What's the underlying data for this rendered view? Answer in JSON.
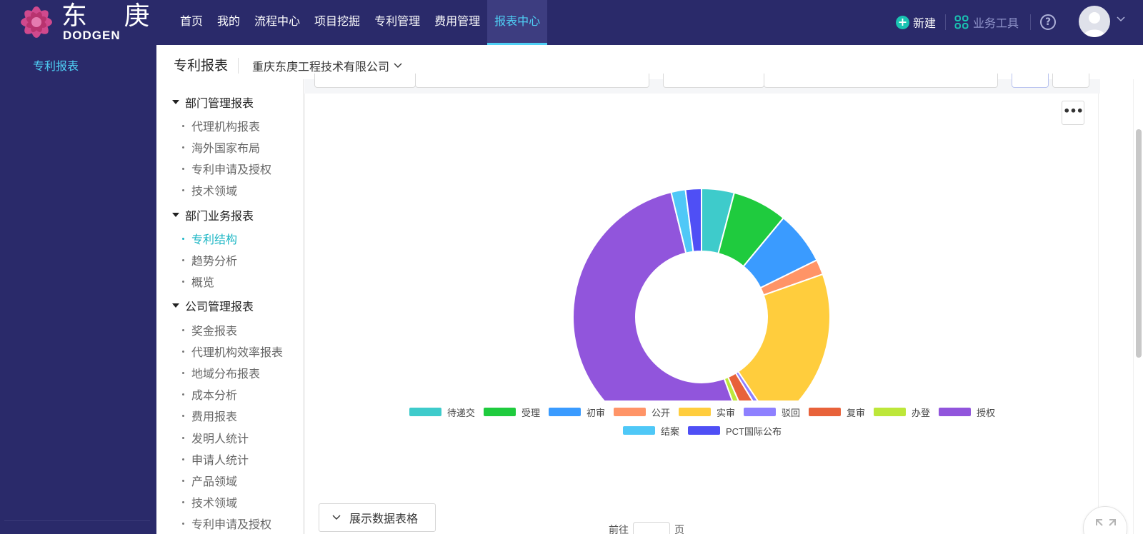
{
  "brand": {
    "name_cn": "东 庚",
    "name_en": "DODGEN"
  },
  "nav": {
    "items": [
      "首页",
      "我的",
      "流程中心",
      "项目挖掘",
      "专利管理",
      "费用管理",
      "报表中心"
    ],
    "active_index": 6
  },
  "toolbar": {
    "new_label": "新建",
    "biz_tools_label": "业务工具",
    "help_label": "?"
  },
  "sidebar": {
    "items": [
      "专利报表"
    ]
  },
  "page": {
    "title": "专利报表",
    "company": "重庆东庚工程技术有限公司"
  },
  "report_tree": {
    "groups": [
      {
        "label": "部门管理报表",
        "items": [
          "代理机构报表",
          "海外国家布局",
          "专利申请及授权",
          "技术领域"
        ]
      },
      {
        "label": "部门业务报表",
        "items": [
          "专利结构",
          "趋势分析",
          "概览"
        ]
      },
      {
        "label": "公司管理报表",
        "items": [
          "奖金报表",
          "代理机构效率报表",
          "地域分布报表",
          "成本分析",
          "费用报表",
          "发明人统计",
          "申请人统计",
          "产品领域",
          "技术领域",
          "专利申请及授权"
        ]
      }
    ],
    "active_item": "专利结构"
  },
  "chart_actions": {
    "more_label": "•••",
    "show_table_label": "展示数据表格"
  },
  "pager": {
    "prefix": "前往",
    "suffix": "页"
  },
  "colors": {
    "nav_bg": "#2a2a6a",
    "accent": "#4fd0f5",
    "active_tree": "#1bb6c4"
  },
  "chart_data": {
    "type": "pie",
    "donut": true,
    "categories": [
      "待递交",
      "受理",
      "初审",
      "公开",
      "实审",
      "驳回",
      "复审",
      "办登",
      "授权",
      "结案",
      "PCT国际公布"
    ],
    "values": [
      4.1,
      6.9,
      6.7,
      1.9,
      21.0,
      0.7,
      2.1,
      1.0,
      51.8,
      1.8,
      2.0
    ],
    "colors": [
      "#3ecbcb",
      "#1fcb3e",
      "#3a9bff",
      "#ff9467",
      "#ffcd3d",
      "#8e80ff",
      "#e8623a",
      "#bde73a",
      "#9155dc",
      "#4fc8f7",
      "#4f4ff5"
    ],
    "legend_position": "bottom"
  }
}
